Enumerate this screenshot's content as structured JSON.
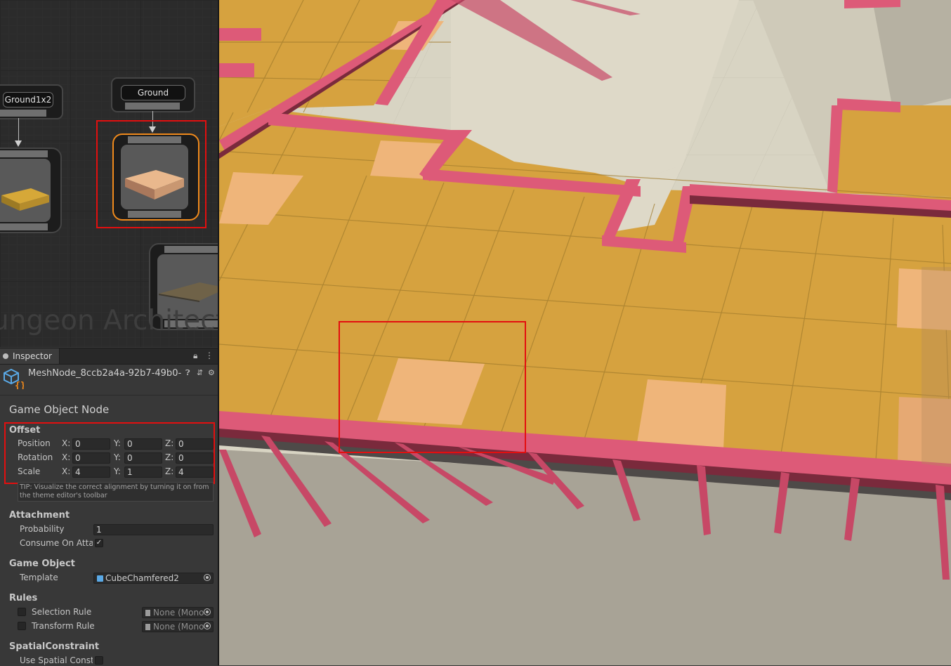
{
  "graph": {
    "nodes": [
      {
        "label": "Ground1x2"
      },
      {
        "label": "Ground"
      }
    ],
    "watermark": "ungeon Architect"
  },
  "inspector": {
    "tab_label": "Inspector",
    "object_name": "MeshNode_8ccb2a4a-92b7-49b0-",
    "component_title": "Game Object Node",
    "offset": {
      "title": "Offset",
      "rows": [
        {
          "label": "Position",
          "x": "0",
          "y": "0",
          "z": "0"
        },
        {
          "label": "Rotation",
          "x": "0",
          "y": "0",
          "z": "0"
        },
        {
          "label": "Scale",
          "x": "4",
          "y": "1",
          "z": "4"
        }
      ],
      "axis_x": "X:",
      "axis_y": "Y:",
      "axis_z": "Z:"
    },
    "tip": "TIP: Visualize the correct alignment by turning it on from the theme editor's toolbar",
    "attachment": {
      "title": "Attachment",
      "probability_label": "Probability",
      "probability_value": "1",
      "consume_label": "Consume On Attac",
      "consume_checked": "✓"
    },
    "game_object": {
      "title": "Game Object",
      "template_label": "Template",
      "template_value": "CubeChamfered2"
    },
    "rules": {
      "title": "Rules",
      "selection_label": "Selection Rule",
      "selection_value": "None (Mono",
      "transform_label": "Transform Rule",
      "transform_value": "None (Mono"
    },
    "spatial": {
      "title": "SpatialConstraint",
      "use_label": "Use Spatial Constr"
    }
  },
  "colors": {
    "highlight_red": "#e30f0f",
    "selected_node_orange": "#f08a1c",
    "floor_tile": "#d6a23f",
    "floor_tile_light": "#efb57a",
    "rail_pink": "#dd5a78",
    "ground_plane": "#d8d4c3"
  }
}
